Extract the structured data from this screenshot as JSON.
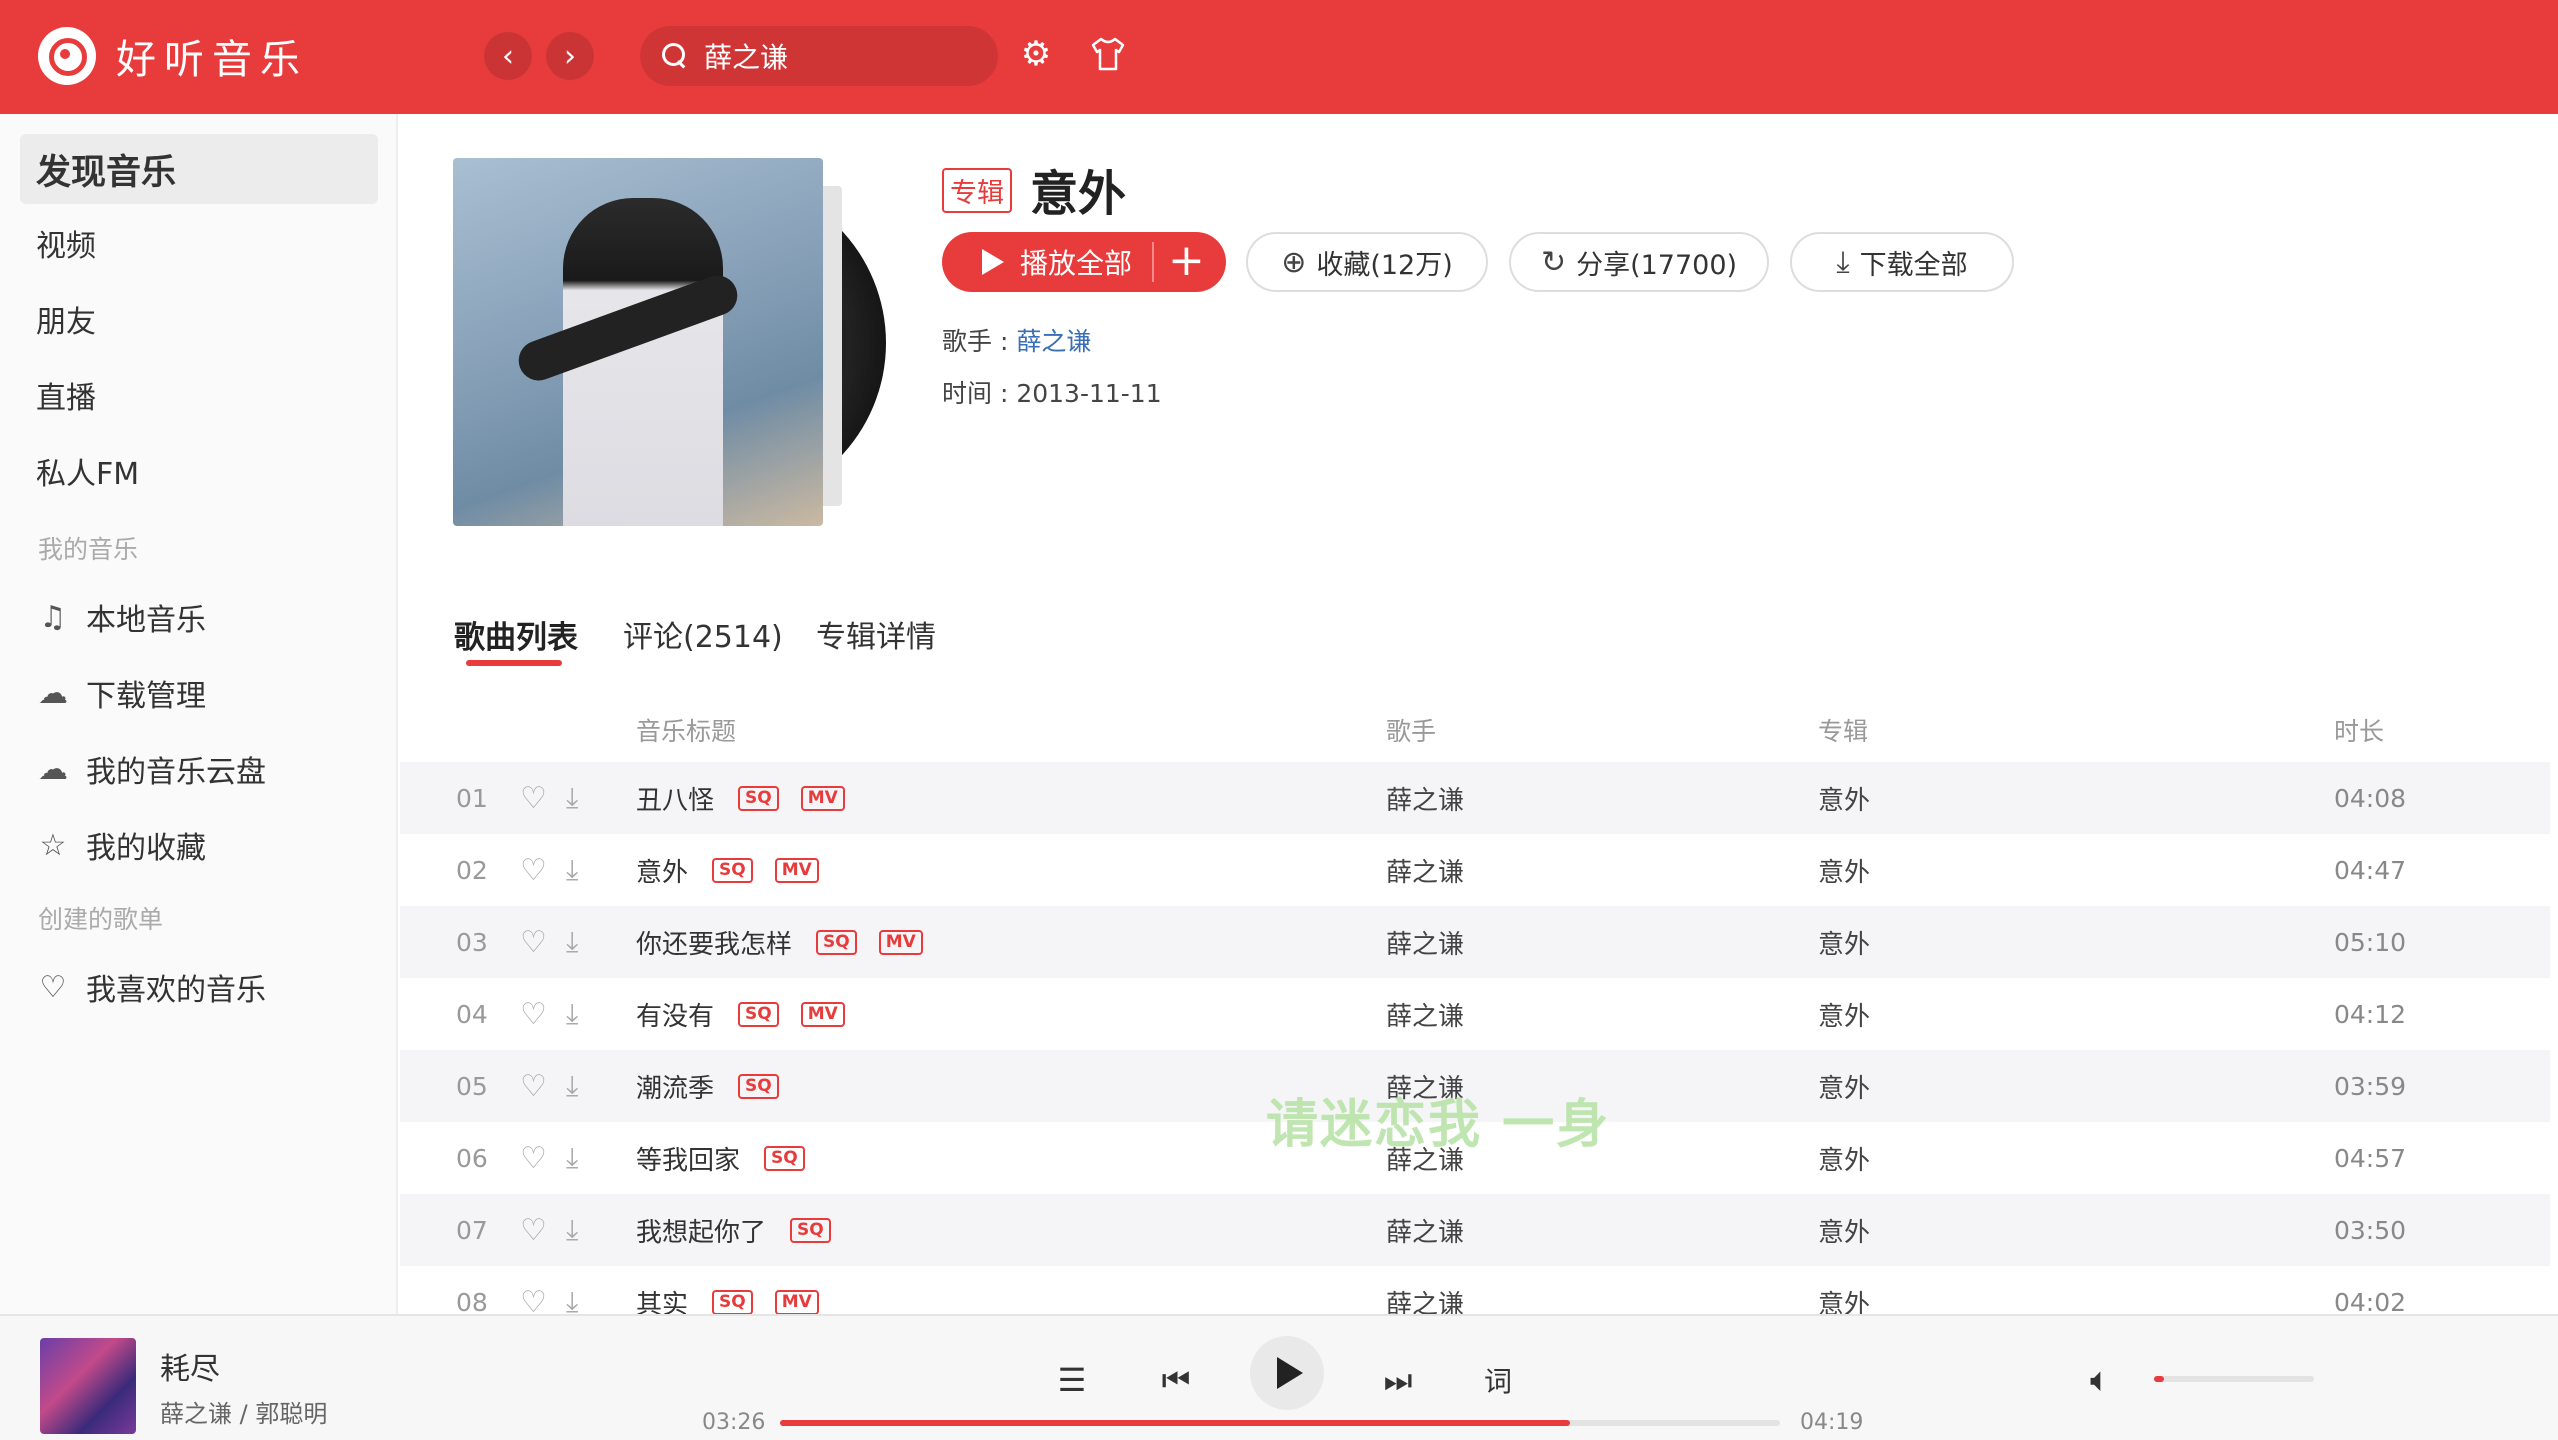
{
  "app": {
    "name": "好听音乐",
    "search_value": "薛之谦",
    "icons": {
      "back": "chevron-left-icon",
      "forward": "chevron-right-icon",
      "settings": "gear-icon",
      "skin": "tshirt-icon"
    }
  },
  "sidebar": {
    "top_items": [
      {
        "label": "发现音乐",
        "active": true
      },
      {
        "label": "视频"
      },
      {
        "label": "朋友"
      },
      {
        "label": "直播"
      },
      {
        "label": "私人FM"
      }
    ],
    "section_my_music": "我的音乐",
    "my_items": [
      {
        "label": "本地音乐",
        "icon": "music-note-icon"
      },
      {
        "label": "下载管理",
        "icon": "download-cloud-icon"
      },
      {
        "label": "我的音乐云盘",
        "icon": "cloud-icon"
      },
      {
        "label": "我的收藏",
        "icon": "star-icon"
      }
    ],
    "section_playlists": "创建的歌单",
    "playlist_items": [
      {
        "label": "我喜欢的音乐",
        "icon": "heart-icon"
      }
    ]
  },
  "album": {
    "badge": "专辑",
    "title": "意外",
    "play_all_label": "播放全部",
    "add_label": "+",
    "collect_label": "收藏(12万)",
    "share_label": "分享(17700)",
    "download_all_label": "下载全部",
    "artist_prefix": "歌手 : ",
    "artist": "薛之谦",
    "time_prefix": "时间 : ",
    "date": "2013-11-11"
  },
  "tabs": [
    {
      "label": "歌曲列表",
      "active": true
    },
    {
      "label": "评论(2514)"
    },
    {
      "label": "专辑详情"
    }
  ],
  "table": {
    "headers": {
      "title": "音乐标题",
      "artist": "歌手",
      "album": "专辑",
      "duration": "时长"
    },
    "rows": [
      {
        "num": "01",
        "title": "丑八怪",
        "sq": "SQ",
        "mv": "MV",
        "artist": "薛之谦",
        "album": "意外",
        "duration": "04:08"
      },
      {
        "num": "02",
        "title": "意外",
        "sq": "SQ",
        "mv": "MV",
        "artist": "薛之谦",
        "album": "意外",
        "duration": "04:47"
      },
      {
        "num": "03",
        "title": "你还要我怎样",
        "sq": "SQ",
        "mv": "MV",
        "artist": "薛之谦",
        "album": "意外",
        "duration": "05:10"
      },
      {
        "num": "04",
        "title": "有没有",
        "sq": "SQ",
        "mv": "MV",
        "artist": "薛之谦",
        "album": "意外",
        "duration": "04:12"
      },
      {
        "num": "05",
        "title": "潮流季",
        "sq": "SQ",
        "mv": "",
        "artist": "薛之谦",
        "album": "意外",
        "duration": "03:59"
      },
      {
        "num": "06",
        "title": "等我回家",
        "sq": "SQ",
        "mv": "",
        "artist": "薛之谦",
        "album": "意外",
        "duration": "04:57"
      },
      {
        "num": "07",
        "title": "我想起你了",
        "sq": "SQ",
        "mv": "",
        "artist": "薛之谦",
        "album": "意外",
        "duration": "03:50"
      },
      {
        "num": "08",
        "title": "其实",
        "sq": "SQ",
        "mv": "MV",
        "artist": "薛之谦",
        "album": "意外",
        "duration": "04:02"
      }
    ]
  },
  "overlay_lyric": "请迷恋我 一身",
  "player": {
    "song": "耗尽",
    "artists": "薛之谦 / 郭聪明",
    "current_time": "03:26",
    "total_time": "04:19",
    "progress": 0.79,
    "volume": 0.06,
    "lyric_button": "词"
  },
  "colors": {
    "accent": "#e83c3c",
    "link": "#3a6eb5"
  }
}
